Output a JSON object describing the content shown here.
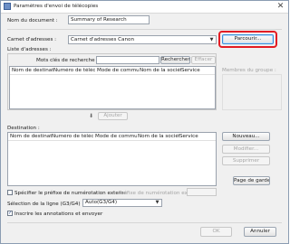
{
  "window": {
    "title": "Paramètres d'envoi de télécopies",
    "close_glyph": "✕"
  },
  "document": {
    "label": "Nom du document :",
    "value": "Summary of Research"
  },
  "address_book": {
    "label": "Carnet d'adresses :",
    "selected": "Carnet d'adresses Canon",
    "browse_label": "Parcourir..."
  },
  "address_list": {
    "label": "Liste d'adresses :",
    "search_label": "Mots clés de recherche :",
    "search_value": "",
    "search_button": "Rechercher",
    "clear_button": "Effacer",
    "columns": [
      "Nom de destination",
      "Numéro de téléco...",
      "Mode de commu...",
      "Nom de la société",
      "Service"
    ]
  },
  "group_members": {
    "label": "Membres du groupe :"
  },
  "add_button": "Ajouter",
  "destination": {
    "label": "Destination :",
    "columns": [
      "Nom de destination",
      "Numéro de téléco...",
      "Mode de commu...",
      "Nom de la société",
      "Service"
    ],
    "new_button": "Nouveau...",
    "edit_button": "Modifier...",
    "delete_button": "Supprimer",
    "cover_page_button": "Page de garde..."
  },
  "prefix": {
    "checkbox_label": "Spécifier le préfixe de numérotation externe",
    "checked": false,
    "field_label": "Préfixe de numérotation externe :",
    "field_value": ""
  },
  "line": {
    "label": "Sélection de la ligne (G3/G4) :",
    "selected": "Auto(G3/G4)"
  },
  "annotations": {
    "checkbox_label": "Inscrire les annotations et envoyer",
    "checked": true,
    "check_glyph": "✓"
  },
  "footer": {
    "ok_button": "OK",
    "cancel_button": "Annuler"
  },
  "icons": {
    "down_arrow_glyph": "▼",
    "add_arrow_glyph": "⬇"
  }
}
